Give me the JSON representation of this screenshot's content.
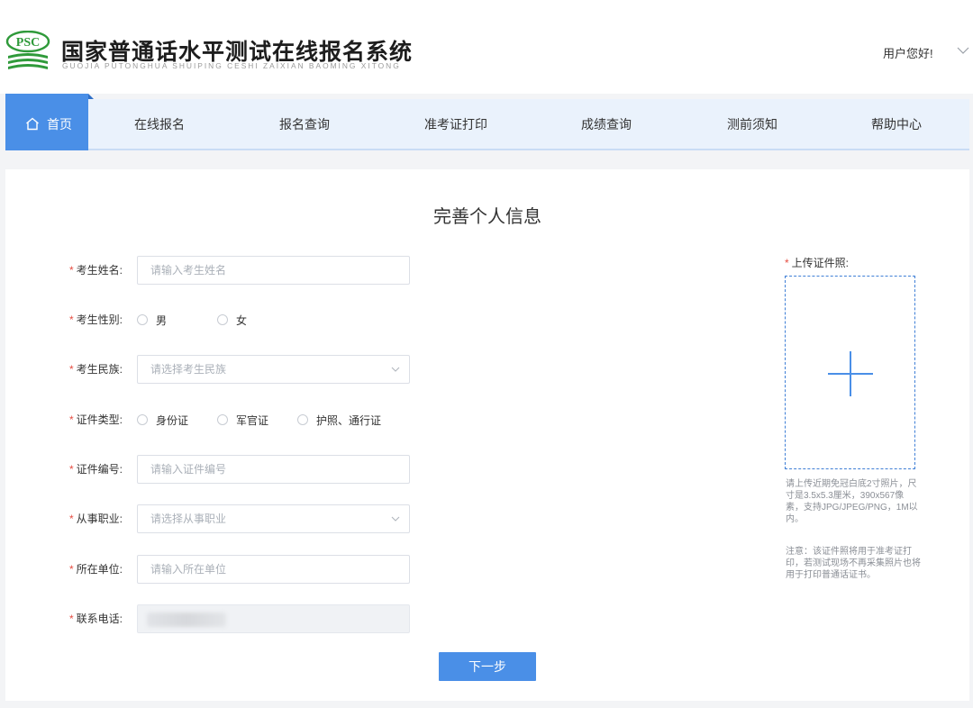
{
  "header": {
    "logo_text": "PSC",
    "title": "国家普通话水平测试在线报名系统",
    "subtitle": "GUOJIA PUTONGHUA SHUIPING CESHI ZAIXIAN BAOMING XITONG",
    "user_greeting": "用户您好!"
  },
  "nav": {
    "home": "首页",
    "items": [
      "在线报名",
      "报名查询",
      "准考证打印",
      "成绩查询",
      "测前须知",
      "帮助中心"
    ]
  },
  "form": {
    "title": "完善个人信息",
    "required_mark": "*",
    "name": {
      "label": "考生姓名:",
      "placeholder": "请输入考生姓名"
    },
    "gender": {
      "label": "考生性别:",
      "options": [
        "男",
        "女"
      ]
    },
    "ethnicity": {
      "label": "考生民族:",
      "placeholder": "请选择考生民族"
    },
    "id_type": {
      "label": "证件类型:",
      "options": [
        "身份证",
        "军官证",
        "护照、通行证"
      ]
    },
    "id_number": {
      "label": "证件编号:",
      "placeholder": "请输入证件编号"
    },
    "occupation": {
      "label": "从事职业:",
      "placeholder": "请选择从事职业"
    },
    "employer": {
      "label": "所在单位:",
      "placeholder": "请输入所在单位"
    },
    "phone": {
      "label": "联系电话:"
    },
    "next_button": "下一步"
  },
  "upload": {
    "label": "上传证件照:",
    "hint": "请上传近期免冠白底2寸照片，尺寸是3.5x5.3厘米，390x567像素，支持JPG/JPEG/PNG，1M以内。",
    "note": "注意：该证件照将用于准考证打印，若测试现场不再采集照片也将用于打印普通话证书。"
  },
  "colors": {
    "primary": "#4a8fe7",
    "nav_bg": "#eaf2fc",
    "required": "#e54d42",
    "logo_green": "#2f9a3a"
  }
}
